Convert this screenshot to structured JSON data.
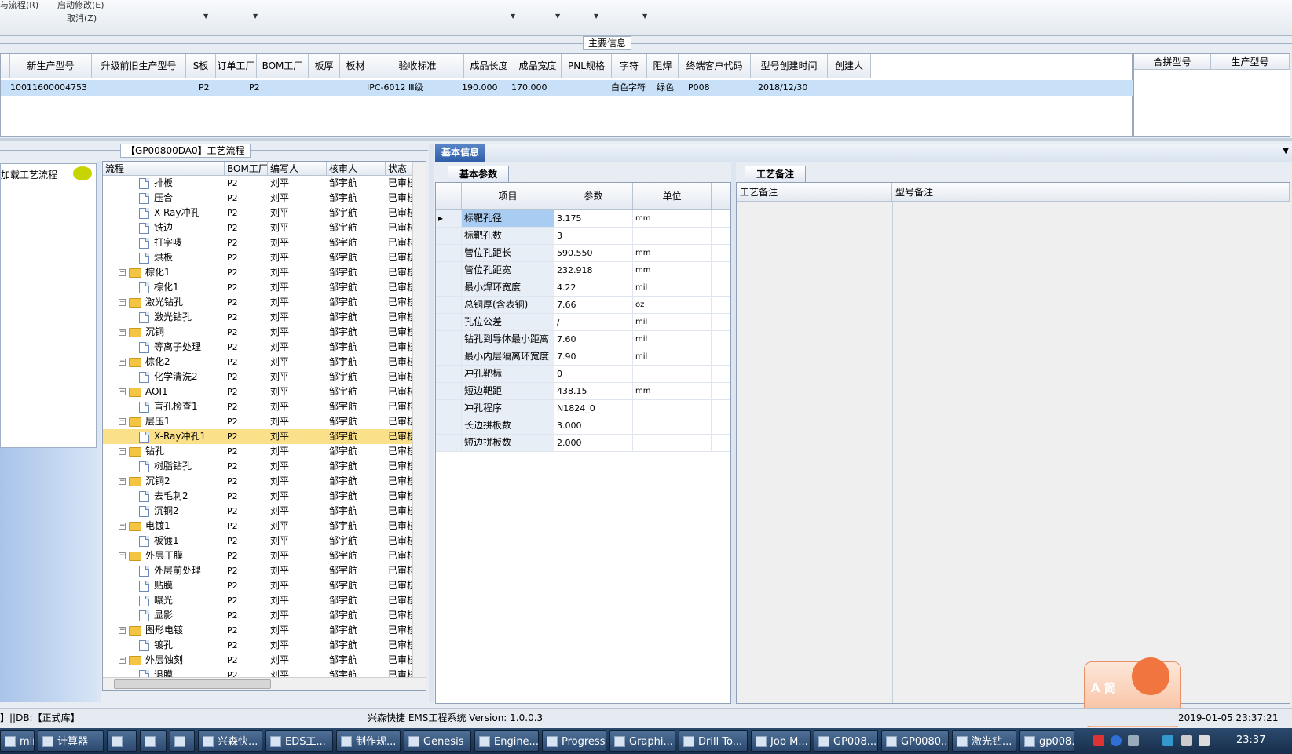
{
  "menu": {
    "item1": "与流程(R)",
    "item2": "启动修改(E)",
    "item3": "取消(Z)"
  },
  "main_info": {
    "group_title": "主要信息",
    "columns": [
      "新生产型号",
      "升级前旧生产型号",
      "S板",
      "订单工厂",
      "BOM工厂",
      "板厚",
      "板材",
      "验收标准",
      "成品长度",
      "成品宽度",
      "PNL规格",
      "字符",
      "阻焊",
      "终端客户代码",
      "型号创建时间",
      "创建人"
    ],
    "row": {
      "new_model": "10011600004753",
      "order_factory": "P2",
      "bom_factory": "P2",
      "acceptance": "IPC-6012 Ⅲ级",
      "length": "190.000",
      "width": "170.000",
      "char": "白色字符",
      "solder": "绿色",
      "customer": "P008",
      "created": "2018/12/30"
    },
    "side_columns": [
      "合拼型号",
      "生产型号"
    ]
  },
  "process": {
    "group_title": "【GP00800DA0】工艺流程",
    "load_label": "加载工艺流程",
    "columns": [
      "流程",
      "BOM工厂",
      "编写人",
      "核审人",
      "状态"
    ],
    "rows": [
      {
        "name": "排板",
        "type": "file",
        "level": 2,
        "bom": "P2",
        "writer": "刘平",
        "reviewer": "邹宇航",
        "status": "已审核"
      },
      {
        "name": "压合",
        "type": "file",
        "level": 2,
        "bom": "P2",
        "writer": "刘平",
        "reviewer": "邹宇航",
        "status": "已审核"
      },
      {
        "name": "X-Ray冲孔",
        "type": "file",
        "level": 2,
        "bom": "P2",
        "writer": "刘平",
        "reviewer": "邹宇航",
        "status": "已审核"
      },
      {
        "name": "铣边",
        "type": "file",
        "level": 2,
        "bom": "P2",
        "writer": "刘平",
        "reviewer": "邹宇航",
        "status": "已审核"
      },
      {
        "name": "打字唛",
        "type": "file",
        "level": 2,
        "bom": "P2",
        "writer": "刘平",
        "reviewer": "邹宇航",
        "status": "已审核"
      },
      {
        "name": "烘板",
        "type": "file",
        "level": 2,
        "bom": "P2",
        "writer": "刘平",
        "reviewer": "邹宇航",
        "status": "已审核"
      },
      {
        "name": "棕化1",
        "type": "folder",
        "level": 1,
        "bom": "P2",
        "writer": "刘平",
        "reviewer": "邹宇航",
        "status": "已审核"
      },
      {
        "name": "棕化1",
        "type": "file",
        "level": 2,
        "bom": "P2",
        "writer": "刘平",
        "reviewer": "邹宇航",
        "status": "已审核"
      },
      {
        "name": "激光钻孔",
        "type": "folder",
        "level": 1,
        "bom": "P2",
        "writer": "刘平",
        "reviewer": "邹宇航",
        "status": "已审核"
      },
      {
        "name": "激光钻孔",
        "type": "file",
        "level": 2,
        "bom": "P2",
        "writer": "刘平",
        "reviewer": "邹宇航",
        "status": "已审核"
      },
      {
        "name": "沉铜",
        "type": "folder",
        "level": 1,
        "bom": "P2",
        "writer": "刘平",
        "reviewer": "邹宇航",
        "status": "已审核"
      },
      {
        "name": "等离子处理",
        "type": "file",
        "level": 2,
        "bom": "P2",
        "writer": "刘平",
        "reviewer": "邹宇航",
        "status": "已审核"
      },
      {
        "name": "棕化2",
        "type": "folder",
        "level": 1,
        "bom": "P2",
        "writer": "刘平",
        "reviewer": "邹宇航",
        "status": "已审核"
      },
      {
        "name": "化学清洗2",
        "type": "file",
        "level": 2,
        "bom": "P2",
        "writer": "刘平",
        "reviewer": "邹宇航",
        "status": "已审核"
      },
      {
        "name": "AOI1",
        "type": "folder",
        "level": 1,
        "bom": "P2",
        "writer": "刘平",
        "reviewer": "邹宇航",
        "status": "已审核"
      },
      {
        "name": "盲孔检查1",
        "type": "file",
        "level": 2,
        "bom": "P2",
        "writer": "刘平",
        "reviewer": "邹宇航",
        "status": "已审核"
      },
      {
        "name": "层压1",
        "type": "folder",
        "level": 1,
        "bom": "P2",
        "writer": "刘平",
        "reviewer": "邹宇航",
        "status": "已审核"
      },
      {
        "name": "X-Ray冲孔1",
        "type": "file",
        "level": 2,
        "bom": "P2",
        "writer": "刘平",
        "reviewer": "邹宇航",
        "status": "已审核",
        "selected": true
      },
      {
        "name": "钻孔",
        "type": "folder",
        "level": 1,
        "bom": "P2",
        "writer": "刘平",
        "reviewer": "邹宇航",
        "status": "已审核"
      },
      {
        "name": "树脂钻孔",
        "type": "file",
        "level": 2,
        "bom": "P2",
        "writer": "刘平",
        "reviewer": "邹宇航",
        "status": "已审核"
      },
      {
        "name": "沉铜2",
        "type": "folder",
        "level": 1,
        "bom": "P2",
        "writer": "刘平",
        "reviewer": "邹宇航",
        "status": "已审核"
      },
      {
        "name": "去毛刺2",
        "type": "file",
        "level": 2,
        "bom": "P2",
        "writer": "刘平",
        "reviewer": "邹宇航",
        "status": "已审核"
      },
      {
        "name": "沉铜2",
        "type": "file",
        "level": 2,
        "bom": "P2",
        "writer": "刘平",
        "reviewer": "邹宇航",
        "status": "已审核"
      },
      {
        "name": "电镀1",
        "type": "folder",
        "level": 1,
        "bom": "P2",
        "writer": "刘平",
        "reviewer": "邹宇航",
        "status": "已审核"
      },
      {
        "name": "板镀1",
        "type": "file",
        "level": 2,
        "bom": "P2",
        "writer": "刘平",
        "reviewer": "邹宇航",
        "status": "已审核"
      },
      {
        "name": "外层干膜",
        "type": "folder",
        "level": 1,
        "bom": "P2",
        "writer": "刘平",
        "reviewer": "邹宇航",
        "status": "已审核"
      },
      {
        "name": "外层前处理",
        "type": "file",
        "level": 2,
        "bom": "P2",
        "writer": "刘平",
        "reviewer": "邹宇航",
        "status": "已审核"
      },
      {
        "name": "贴膜",
        "type": "file",
        "level": 2,
        "bom": "P2",
        "writer": "刘平",
        "reviewer": "邹宇航",
        "status": "已审核"
      },
      {
        "name": "曝光",
        "type": "file",
        "level": 2,
        "bom": "P2",
        "writer": "刘平",
        "reviewer": "邹宇航",
        "status": "已审核"
      },
      {
        "name": "显影",
        "type": "file",
        "level": 2,
        "bom": "P2",
        "writer": "刘平",
        "reviewer": "邹宇航",
        "status": "已审核"
      },
      {
        "name": "图形电镀",
        "type": "folder",
        "level": 1,
        "bom": "P2",
        "writer": "刘平",
        "reviewer": "邹宇航",
        "status": "已审核"
      },
      {
        "name": "镀孔",
        "type": "file",
        "level": 2,
        "bom": "P2",
        "writer": "刘平",
        "reviewer": "邹宇航",
        "status": "已审核"
      },
      {
        "name": "外层蚀刻",
        "type": "folder",
        "level": 1,
        "bom": "P2",
        "writer": "刘平",
        "reviewer": "邹宇航",
        "status": "已审核"
      },
      {
        "name": "退膜",
        "type": "file",
        "level": 2,
        "bom": "P2",
        "writer": "刘平",
        "reviewer": "邹宇航",
        "status": "已审核"
      }
    ]
  },
  "basic_info": {
    "title": "基本信息",
    "params_tab": "基本参数",
    "columns": [
      "项目",
      "参数",
      "单位"
    ],
    "rows": [
      {
        "item": "标靶孔径",
        "value": "3.175",
        "unit": "mm"
      },
      {
        "item": "标靶孔数",
        "value": "3",
        "unit": ""
      },
      {
        "item": "管位孔距长",
        "value": "590.550",
        "unit": "mm"
      },
      {
        "item": "管位孔距宽",
        "value": "232.918",
        "unit": "mm"
      },
      {
        "item": "最小焊环宽度",
        "value": "4.22",
        "unit": "mil"
      },
      {
        "item": "总铜厚(含表铜)",
        "value": "7.66",
        "unit": "oz"
      },
      {
        "item": "孔位公差",
        "value": "/",
        "unit": "mil"
      },
      {
        "item": "钻孔到导体最小距离",
        "value": "7.60",
        "unit": "mil"
      },
      {
        "item": "最小内层隔离环宽度",
        "value": "7.90",
        "unit": "mil"
      },
      {
        "item": "冲孔靶标",
        "value": "0",
        "unit": ""
      },
      {
        "item": "短边靶距",
        "value": "438.15",
        "unit": "mm"
      },
      {
        "item": "冲孔程序",
        "value": "N1824_0",
        "unit": ""
      },
      {
        "item": "长边拼板数",
        "value": "3.000",
        "unit": ""
      },
      {
        "item": "短边拼板数",
        "value": "2.000",
        "unit": ""
      }
    ],
    "notes_tab": "工艺备注",
    "notes_col1": "工艺备注",
    "notes_col2": "型号备注"
  },
  "status_bar": {
    "db": "】||DB:【正式库】",
    "app": "兴森快捷 EMS工程系统 Version: 1.0.0.3",
    "datetime": "2019-01-05 23:37:21"
  },
  "mascot_label": "A 简",
  "taskbar": {
    "items": [
      "mini...",
      "计算器",
      "",
      "",
      "",
      "兴森快...",
      "EDS工...",
      "制作规...",
      "Genesis",
      "Engine...",
      "Progress",
      "Graphi...",
      "Drill To...",
      "Job M...",
      "GP008...",
      "GP0080...",
      "激光钻...",
      "gp008..."
    ],
    "clock": "23:37"
  },
  "colors": {
    "selected_row": "#c9e1f8",
    "tree_selected": "#fbe08a",
    "folder": "#f4c542",
    "tab_blue": "#2f5ea8"
  }
}
